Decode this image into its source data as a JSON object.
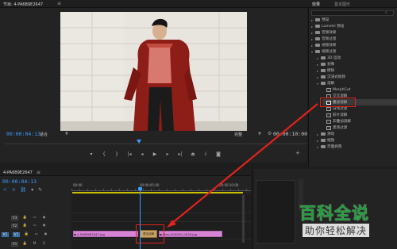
{
  "monitor": {
    "title": "节目: 4-PA6B9E2647",
    "menu_icon": "menu-icon",
    "timecode_left": "00:00:04:13",
    "fit_label": "适合",
    "quality_label": "完整",
    "timecode_right": "00:00:10:00",
    "transport_icons": [
      "marker-icon",
      "mark-in-icon",
      "mark-out-icon",
      "go-to-in-icon",
      "step-back-icon",
      "play-icon",
      "step-forward-icon",
      "go-to-out-icon",
      "lift-icon",
      "extract-icon",
      "export-frame-icon"
    ]
  },
  "effects_panel": {
    "tabs": [
      "效果",
      "基本图形"
    ],
    "items": [
      {
        "label": "预设",
        "kind": "folder",
        "indent": 0
      },
      {
        "label": "Lumetri 预设",
        "kind": "folder",
        "indent": 0
      },
      {
        "label": "音频效果",
        "kind": "folder",
        "indent": 0
      },
      {
        "label": "音频过渡",
        "kind": "folder",
        "indent": 0
      },
      {
        "label": "视频效果",
        "kind": "folder",
        "indent": 0
      },
      {
        "label": "视频过渡",
        "kind": "folder",
        "indent": 0,
        "open": true
      },
      {
        "label": "3D 运动",
        "kind": "folder",
        "indent": 1
      },
      {
        "label": "划像",
        "kind": "folder",
        "indent": 1
      },
      {
        "label": "擦除",
        "kind": "folder",
        "indent": 1
      },
      {
        "label": "沉浸式视频",
        "kind": "folder",
        "indent": 1
      },
      {
        "label": "溶解",
        "kind": "folder",
        "indent": 1,
        "open": true
      },
      {
        "label": "MorphCut",
        "kind": "effect",
        "indent": 2
      },
      {
        "label": "交叉溶解",
        "kind": "effect",
        "indent": 2
      },
      {
        "label": "叠加溶解",
        "kind": "effect",
        "indent": 2,
        "selected": true
      },
      {
        "label": "白场过渡",
        "kind": "effect",
        "indent": 2
      },
      {
        "label": "胶片溶解",
        "kind": "effect",
        "indent": 2
      },
      {
        "label": "非叠加溶解",
        "kind": "effect",
        "indent": 2
      },
      {
        "label": "黑场过渡",
        "kind": "effect",
        "indent": 2
      },
      {
        "label": "滑动",
        "kind": "folder",
        "indent": 1
      },
      {
        "label": "缩放",
        "kind": "folder",
        "indent": 1
      },
      {
        "label": "页面剥落",
        "kind": "folder",
        "indent": 1
      }
    ]
  },
  "timeline": {
    "title": "4-PA6B9E2647",
    "timecode": "00:00:04:13",
    "ruler_labels": [
      "00:00",
      "00:00:05:00",
      "00:00:10:00"
    ],
    "track_headers": [
      {
        "id": "V3",
        "active": false
      },
      {
        "id": "V2",
        "active": false
      },
      {
        "id": "V1",
        "active": true
      }
    ],
    "clips": [
      {
        "name": "4-PA6B9E2647.jpg"
      },
      {
        "name": "timo-000000_0026.jpg"
      }
    ],
    "transition_label": "叠加溶解"
  },
  "watermark": {
    "title": "百科全说",
    "subtitle": "助你轻松解决"
  },
  "colors": {
    "accent_blue": "#3b9dff",
    "clip_pink": "#d784d6",
    "highlight_red": "#e0231a",
    "watermark_green": "#1f9e3a"
  }
}
